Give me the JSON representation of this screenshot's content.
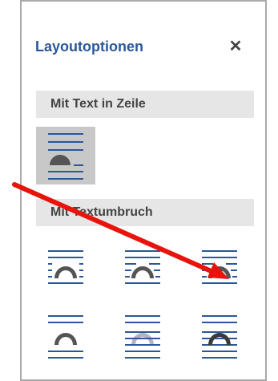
{
  "panel": {
    "title": "Layoutoptionen",
    "close_glyph": "✕",
    "accent_color": "#2b579a",
    "icon_line_color": "#2b579a"
  },
  "sections": [
    {
      "label": "Mit Text in Zeile",
      "options": [
        {
          "name": "inline-with-text",
          "selected": true
        }
      ]
    },
    {
      "label": "Mit Textumbruch",
      "options": [
        {
          "name": "square"
        },
        {
          "name": "tight"
        },
        {
          "name": "through"
        },
        {
          "name": "top-and-bottom"
        },
        {
          "name": "behind-text"
        },
        {
          "name": "in-front-of-text"
        }
      ]
    }
  ],
  "annotation": {
    "color": "#e8140c",
    "icon": "red-arrow"
  }
}
